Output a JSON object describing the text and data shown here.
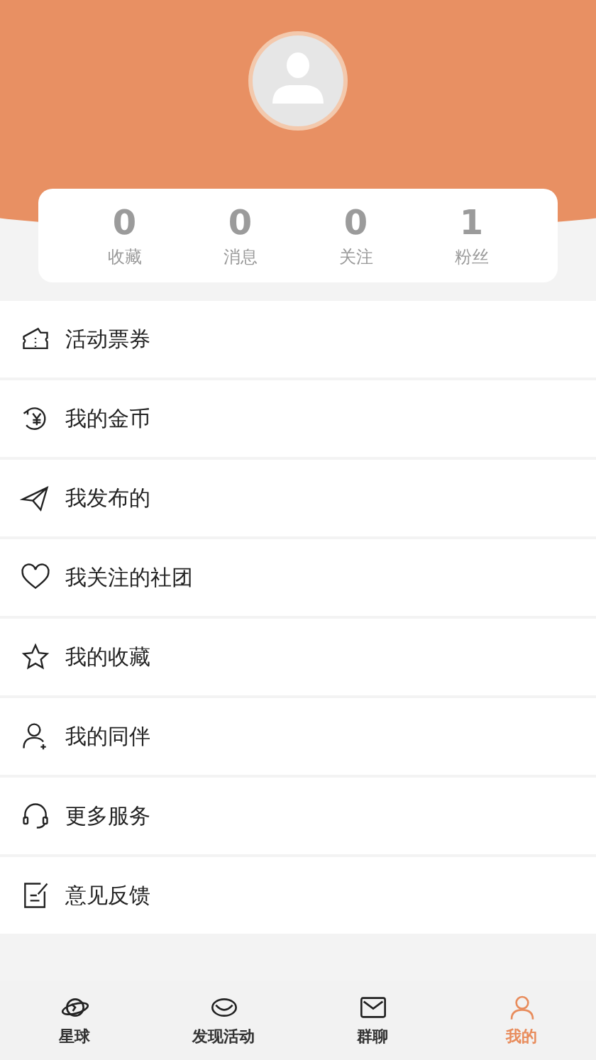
{
  "stats": [
    {
      "value": "0",
      "label": "收藏"
    },
    {
      "value": "0",
      "label": "消息"
    },
    {
      "value": "0",
      "label": "关注"
    },
    {
      "value": "1",
      "label": "粉丝"
    }
  ],
  "menu": [
    {
      "kind": "ticket",
      "label": "活动票券"
    },
    {
      "kind": "coin",
      "label": "我的金币"
    },
    {
      "kind": "send",
      "label": "我发布的"
    },
    {
      "kind": "heart",
      "label": "我关注的社团"
    },
    {
      "kind": "star",
      "label": "我的收藏"
    },
    {
      "kind": "companion",
      "label": "我的同伴"
    },
    {
      "kind": "service",
      "label": "更多服务"
    },
    {
      "kind": "feedback",
      "label": "意见反馈"
    }
  ],
  "tabs": [
    {
      "kind": "planet",
      "label": "星球",
      "selected": false
    },
    {
      "kind": "discover",
      "label": "发现活动",
      "selected": false
    },
    {
      "kind": "chat",
      "label": "群聊",
      "selected": false
    },
    {
      "kind": "profile",
      "label": "我的",
      "selected": true
    }
  ]
}
